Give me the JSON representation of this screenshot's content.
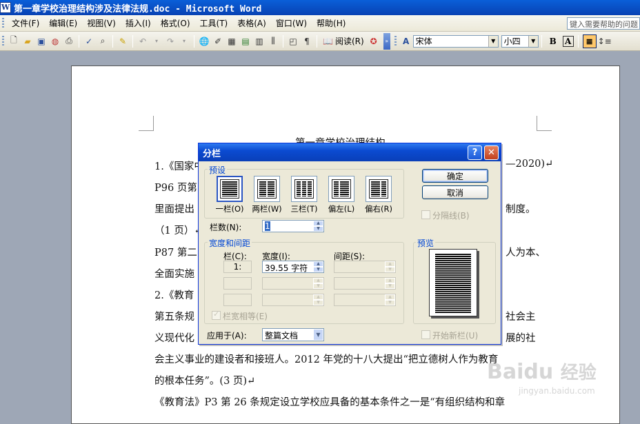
{
  "window": {
    "title": "第一章学校治理结构涉及法律法规.doc - Microsoft Word",
    "app_icon": "W"
  },
  "menu": {
    "items": [
      "文件(F)",
      "编辑(E)",
      "视图(V)",
      "插入(I)",
      "格式(O)",
      "工具(T)",
      "表格(A)",
      "窗口(W)",
      "帮助(H)"
    ],
    "help_placeholder": "键入需要帮助的问题"
  },
  "toolbar": {
    "read_label": "阅读(R)",
    "font_name": "宋体",
    "font_size": "小四",
    "bold": "B",
    "char_border": "A"
  },
  "document": {
    "heading": "第一章学校治理结构",
    "lines": [
      "1.《国家中",
      "P96 页第",
      "里面提出",
      "（1 页）↵",
      "P87 第二",
      "全面实施",
      "2.《教育",
      "第五条规",
      "义现代化",
      "会主义事业的建设者和接班人。2012 年党的十八大提出“把立德树人作为教育",
      "的根本任务”。(3 页)↵",
      "《教育法》P3 第 26 条规定设立学校应具备的基本条件之一是“有组织结构和章"
    ],
    "right_fragments": [
      "—2020)↵",
      "制度。",
      "人为本、",
      "社会主",
      "展的社"
    ]
  },
  "dialog": {
    "title": "分栏",
    "presets_label": "预设",
    "presets": [
      {
        "label": "一栏(O)",
        "icon": "one-column-icon"
      },
      {
        "label": "两栏(W)",
        "icon": "two-columns-icon"
      },
      {
        "label": "三栏(T)",
        "icon": "three-columns-icon"
      },
      {
        "label": "偏左(L)",
        "icon": "left-column-icon"
      },
      {
        "label": "偏右(R)",
        "icon": "right-column-icon"
      }
    ],
    "ok": "确定",
    "cancel": "取消",
    "separator_label": "分隔线(B)",
    "num_columns_label": "栏数(N):",
    "num_columns_value": "1",
    "width_spacing_label": "宽度和间距",
    "col_header": "栏(C):",
    "width_header": "宽度(I):",
    "spacing_header": "间距(S):",
    "row1_col": "1:",
    "row1_width": "39.55 字符",
    "equal_width_label": "栏宽相等(E)",
    "apply_label": "应用于(A):",
    "apply_value": "整篇文档",
    "preview_label": "预览",
    "new_column_label": "开始新栏(U)"
  },
  "watermark": {
    "brand": "Baidu",
    "cn": "经验",
    "url": "jingyan.baidu.com"
  }
}
